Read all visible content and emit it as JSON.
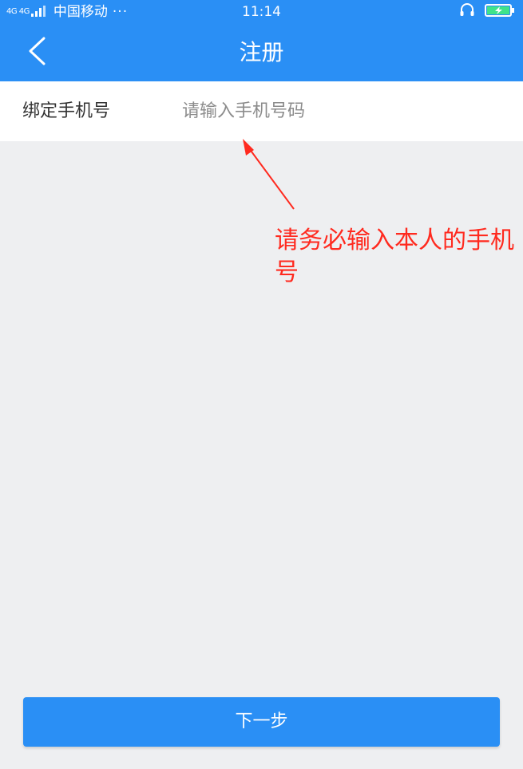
{
  "status_bar": {
    "network": "4G 4G",
    "carrier": "中国移动",
    "more": "···",
    "time": "11:14",
    "icons": [
      "headset-icon",
      "battery-charging-icon"
    ]
  },
  "nav": {
    "back_icon": "chevron-left-icon",
    "title": "注册"
  },
  "form": {
    "phone_label": "绑定手机号",
    "phone_placeholder": "请输入手机号码",
    "phone_value": ""
  },
  "annotation": {
    "text": "请务必输入本人的手机号",
    "color": "#ff2a1f"
  },
  "actions": {
    "next_label": "下一步"
  },
  "colors": {
    "primary": "#2a8ff5",
    "background": "#eeeff1",
    "annotation": "#ff2a1f"
  }
}
